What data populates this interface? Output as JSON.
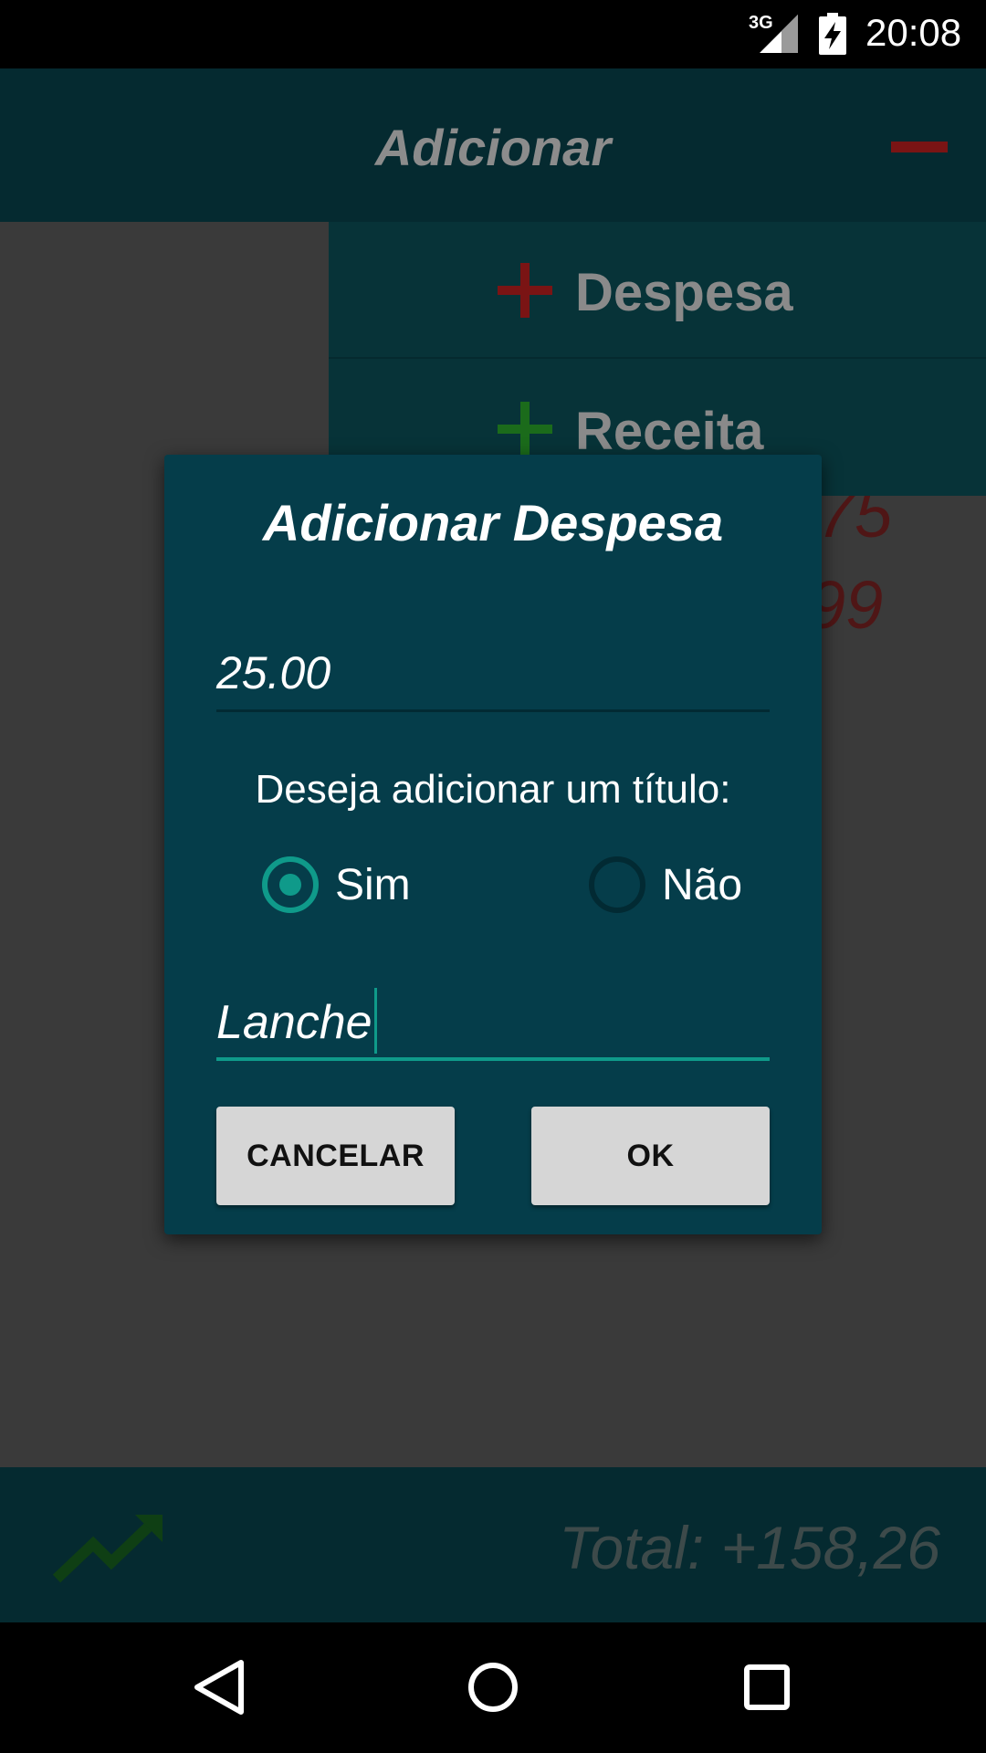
{
  "status_bar": {
    "network": "3G",
    "time": "20:08",
    "icons": [
      "signal-icon",
      "battery-charging-icon"
    ]
  },
  "app_bar": {
    "title": "Adicionar",
    "action_icon": "minus-icon"
  },
  "add_menu": {
    "items": [
      {
        "label": "Despesa",
        "icon": "plus-icon",
        "color": "#7a1414"
      },
      {
        "label": "Receita",
        "icon": "plus-icon",
        "color": "#1b6b1b"
      }
    ]
  },
  "background_values": {
    "value_1": "75",
    "value_2": "99"
  },
  "dialog": {
    "title": "Adicionar Despesa",
    "amount_value": "25.00",
    "question": "Deseja adicionar um título:",
    "radio_sim": "Sim",
    "radio_nao": "Não",
    "selected": "Sim",
    "title_value": "Lanche",
    "cancel_label": "CANCELAR",
    "ok_label": "OK"
  },
  "total_bar": {
    "text": "Total:  +158,26",
    "icon": "trending-up-icon"
  },
  "nav_bar": {
    "buttons": [
      "back-icon",
      "home-icon",
      "recents-icon"
    ]
  },
  "colors": {
    "accent": "#0f9a8a",
    "dialog_bg": "#053d4a",
    "app_bar": "#052a30"
  }
}
